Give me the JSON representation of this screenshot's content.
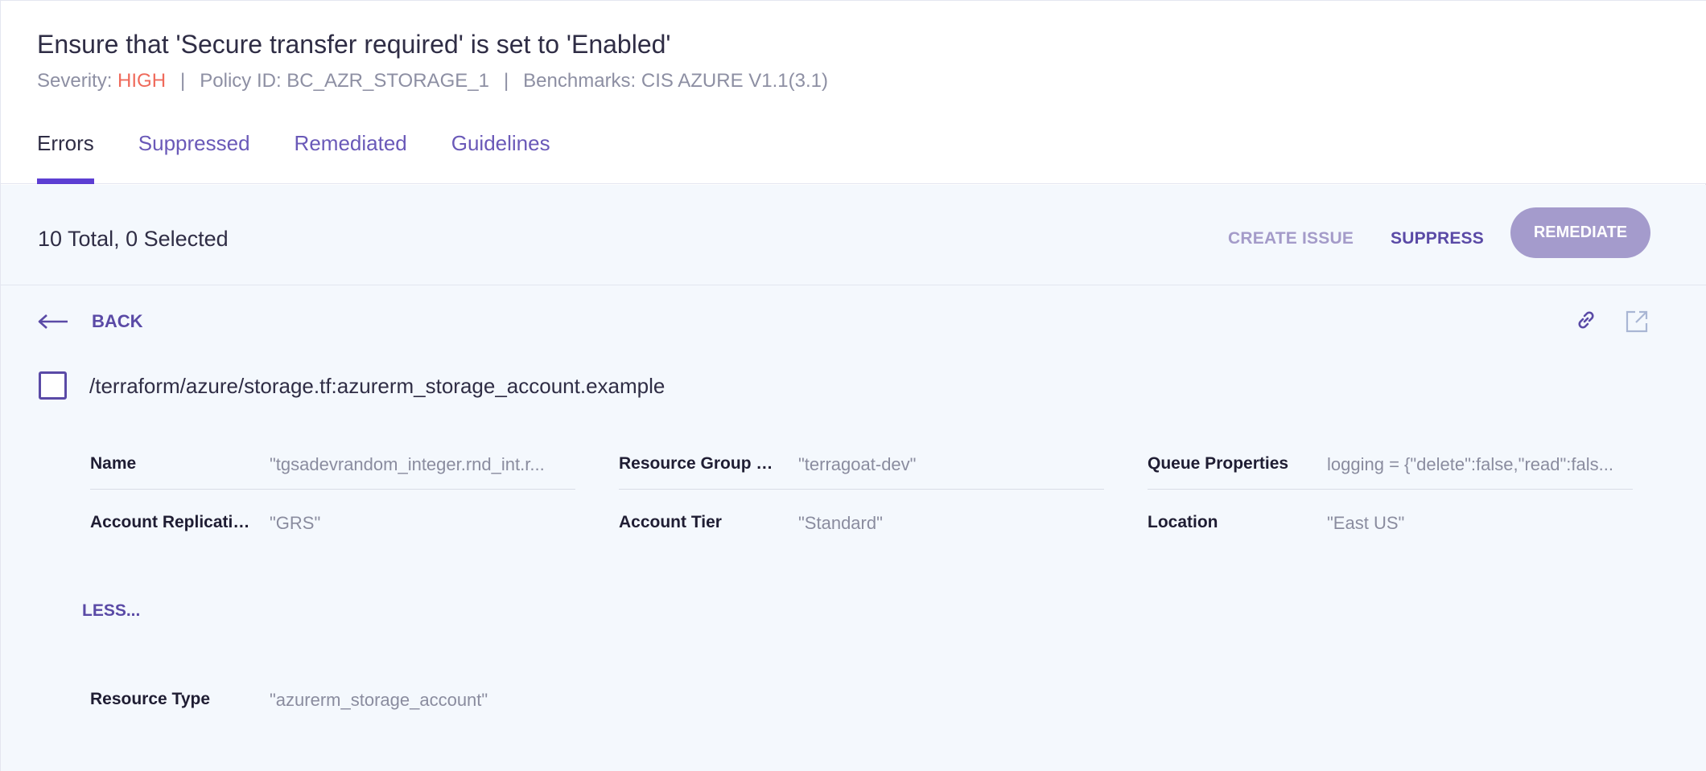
{
  "policy": {
    "title": "Ensure that 'Secure transfer required' is set to 'Enabled'",
    "severity_label": "Severity: ",
    "severity_value": "HIGH",
    "separator": "|",
    "policy_id": "Policy ID: BC_AZR_STORAGE_1",
    "benchmarks": "Benchmarks: CIS AZURE V1.1(3.1)"
  },
  "tabs": [
    {
      "label": "Errors",
      "active": true
    },
    {
      "label": "Suppressed",
      "active": false
    },
    {
      "label": "Remediated",
      "active": false
    },
    {
      "label": "Guidelines",
      "active": false
    }
  ],
  "toolbar": {
    "count_text": "10 Total, 0 Selected",
    "create_issue": "CREATE ISSUE",
    "suppress": "SUPPRESS",
    "remediate": "REMEDIATE"
  },
  "detail": {
    "back_label": "BACK",
    "resource_path": "/terraform/azure/storage.tf:azurerm_storage_account.example",
    "less_label": "LESS...",
    "fields": [
      {
        "key": "Name",
        "value": "\"tgsadevrandom_integer.rnd_int.r..."
      },
      {
        "key": "Resource Group Na...",
        "value": "\"terragoat-dev\""
      },
      {
        "key": "Queue Properties",
        "value": "logging = {\"delete\":false,\"read\":fals..."
      },
      {
        "key": "Account Replicatio...",
        "value": "\"GRS\""
      },
      {
        "key": "Account Tier",
        "value": "\"Standard\""
      },
      {
        "key": "Location",
        "value": "\"East US\""
      },
      {
        "key": "Resource Type",
        "value": "\"azurerm_storage_account\""
      }
    ]
  },
  "icons": {
    "back": "arrow-left-icon",
    "link": "link-icon",
    "open": "external-link-icon",
    "checkbox": "checkbox-icon"
  },
  "colors": {
    "accent": "#5d3fd3",
    "link_text": "#5a4aa6",
    "severity_high": "#ef6a5b",
    "remediate_bg": "#a49bcc",
    "content_bg": "#f4f8fd"
  }
}
